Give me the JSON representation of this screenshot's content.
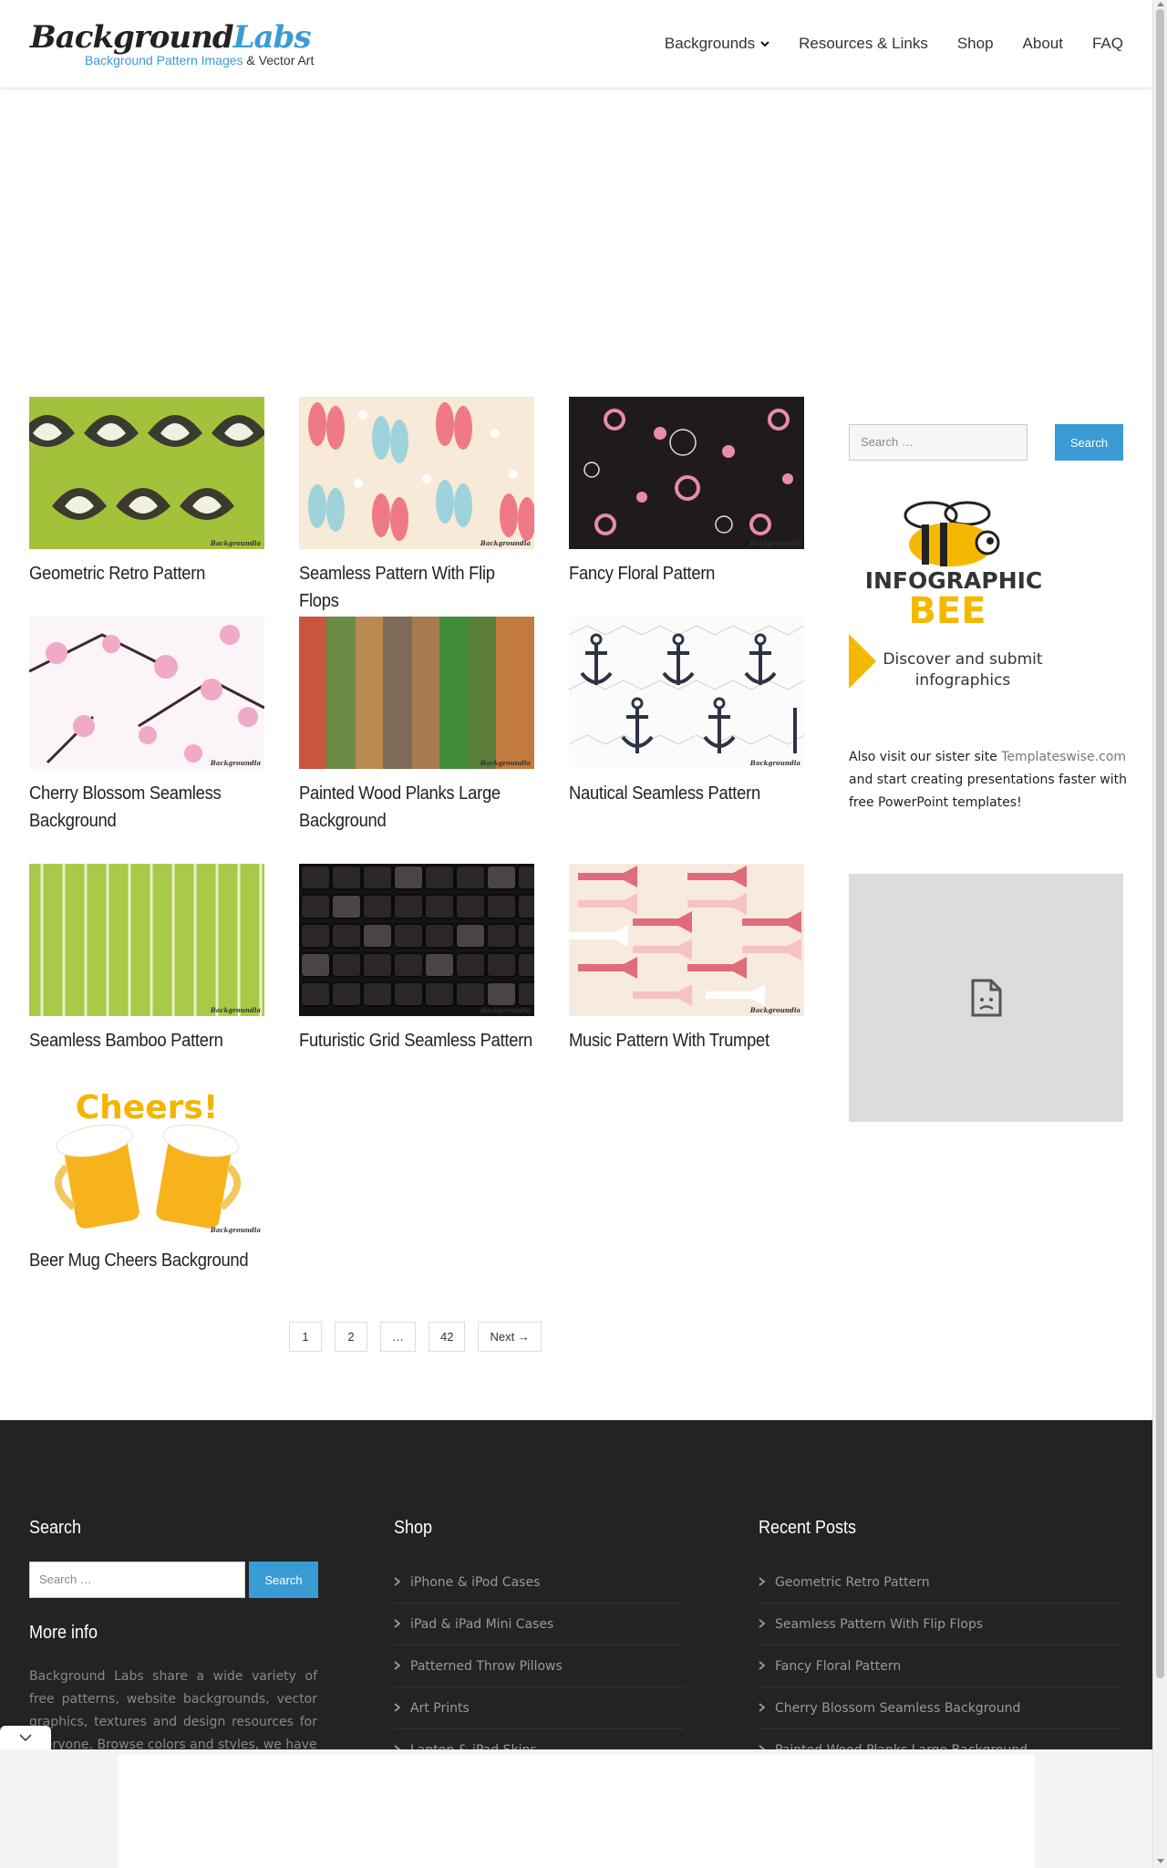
{
  "logo": {
    "brand_a": "Background",
    "brand_b": "Labs",
    "tagline_a": "Background Pattern Images",
    "tagline_b": " & Vector Art"
  },
  "nav": {
    "backgrounds": "Backgrounds",
    "resources": "Resources & Links",
    "shop": "Shop",
    "about": "About",
    "faq": "FAQ"
  },
  "posts": [
    {
      "title": "Geometric Retro Pattern"
    },
    {
      "title": "Seamless Pattern With Flip Flops"
    },
    {
      "title": "Fancy Floral Pattern"
    },
    {
      "title": "Cherry Blossom Seamless Background"
    },
    {
      "title": "Painted Wood Planks Large Background"
    },
    {
      "title": "Nautical Seamless Pattern"
    },
    {
      "title": "Seamless Bamboo Pattern"
    },
    {
      "title": "Futuristic Grid Seamless Pattern"
    },
    {
      "title": "Music Pattern With Trumpet"
    },
    {
      "title": "Beer Mug Cheers Background"
    }
  ],
  "thumb_watermark": "Backgroundla",
  "beer_text": "Cheers!",
  "pagination": {
    "p1": "1",
    "p2": "2",
    "dots": "…",
    "last": "42",
    "next": "Next →"
  },
  "sidebar": {
    "search_placeholder": "Search …",
    "search_button": "Search",
    "bee_title_1": "INFOGRAPHIC",
    "bee_title_2": "BEE",
    "bee_tag_1": "Discover and submit",
    "bee_tag_2": "infographics",
    "sister_a": "Also visit our sister site ",
    "sister_link": "Templateswise.com",
    "sister_b": " and start creating presentations faster with free PowerPoint templates!"
  },
  "footer": {
    "search_heading": "Search",
    "search_placeholder": "Search …",
    "search_button": "Search",
    "more_heading": "More info",
    "more_text": "Background Labs share a wide variety of free patterns, website backgrounds, vector graphics, textures and design resources for everyone. Browse colors and styles, we have",
    "shop_heading": "Shop",
    "shop_items": [
      "iPhone & iPod Cases",
      "iPad & iPad Mini Cases",
      "Patterned Throw Pillows",
      "Art Prints",
      "Laptop & iPad Skins"
    ],
    "recent_heading": "Recent Posts",
    "recent_items": [
      "Geometric Retro Pattern",
      "Seamless Pattern With Flip Flops",
      "Fancy Floral Pattern",
      "Cherry Blossom Seamless Background",
      "Painted Wood Planks Large Background"
    ]
  },
  "colors": {
    "accent": "#3a9bd5",
    "footer_bg": "#232323",
    "bee_yellow": "#f5b800"
  }
}
